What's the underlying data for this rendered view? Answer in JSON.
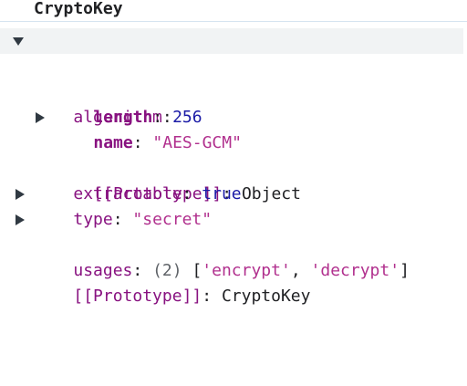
{
  "object_title": "CryptoKey",
  "algorithm": {
    "key": "algorithm",
    "length_key": "length",
    "length_value": "256",
    "name_key": "name",
    "name_value": "\"AES-GCM\"",
    "proto_key": "[[Prototype]]",
    "proto_value": "Object"
  },
  "extractable": {
    "key": "extractable",
    "value": "true"
  },
  "type": {
    "key": "type",
    "value": "\"secret\""
  },
  "usages": {
    "key": "usages",
    "count": "(2)",
    "open_bracket": "[",
    "item1": "'encrypt'",
    "separator": ", ",
    "item2": "'decrypt'",
    "close_bracket": "]"
  },
  "prototype": {
    "key": "[[Prototype]]",
    "value": "CryptoKey"
  },
  "colon": ":",
  "icons": {
    "expanded": "triangle-down-icon",
    "collapsed": "triangle-right-icon"
  },
  "colors": {
    "key": "#881280",
    "number": "#1a1aa6",
    "string": "#b1308e",
    "keyword": "#1a1aa6",
    "hover_bg": "#f1f3f4"
  }
}
